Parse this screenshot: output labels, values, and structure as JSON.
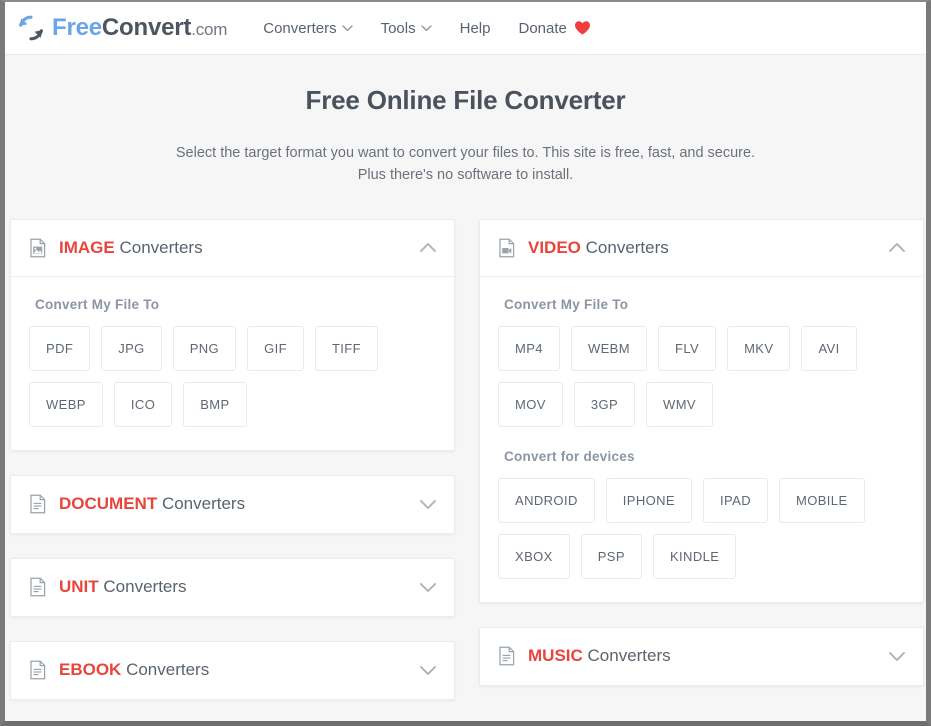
{
  "header": {
    "logo": {
      "icon": "refresh-circle-icon",
      "part1": "Free",
      "part2": "Convert",
      "part3": ".com"
    },
    "nav": [
      {
        "label": "Converters",
        "icon": "chevron-down-icon",
        "has_chevron": true
      },
      {
        "label": "Tools",
        "icon": "chevron-down-icon",
        "has_chevron": true
      },
      {
        "label": "Help",
        "has_chevron": false
      },
      {
        "label": "Donate",
        "icon": "heart-icon",
        "has_heart": true
      }
    ]
  },
  "hero": {
    "title": "Free Online File Converter",
    "subtitle": "Select the target format you want to convert your files to. This site is free, fast, and secure. Plus there's no software to install."
  },
  "colors": {
    "accent_red": "#e8453c",
    "logo_blue": "#6ba4e8",
    "text_gray": "#5a636d",
    "label_gray": "#8b95a3",
    "page_bg": "#f6f6f7",
    "card_bg": "#ffffff",
    "border": "#ececec",
    "heart_red": "#ee3d3d"
  },
  "left_column": [
    {
      "id": "image",
      "kind": "IMAGE",
      "suffix": " Converters",
      "icon": "file-image-icon",
      "expanded": true,
      "chevron": "chevron-up-icon",
      "groups": [
        {
          "label": "Convert My File To",
          "items": [
            "PDF",
            "JPG",
            "PNG",
            "GIF",
            "TIFF",
            "WEBP",
            "ICO",
            "BMP"
          ]
        }
      ]
    },
    {
      "id": "document",
      "kind": "DOCUMENT",
      "suffix": " Converters",
      "icon": "file-lines-icon",
      "expanded": false,
      "chevron": "chevron-down-icon",
      "groups": []
    },
    {
      "id": "unit",
      "kind": "UNIT",
      "suffix": " Converters",
      "icon": "file-lines-icon",
      "expanded": false,
      "chevron": "chevron-down-icon",
      "groups": []
    },
    {
      "id": "ebook",
      "kind": "EBOOK",
      "suffix": " Converters",
      "icon": "file-lines-icon",
      "expanded": false,
      "chevron": "chevron-down-icon",
      "groups": []
    }
  ],
  "right_column": [
    {
      "id": "video",
      "kind": "VIDEO",
      "suffix": " Converters",
      "icon": "file-video-icon",
      "expanded": true,
      "chevron": "chevron-up-icon",
      "groups": [
        {
          "label": "Convert My File To",
          "items": [
            "MP4",
            "WEBM",
            "FLV",
            "MKV",
            "AVI",
            "MOV",
            "3GP",
            "WMV"
          ]
        },
        {
          "label": "Convert for devices",
          "items": [
            "ANDROID",
            "IPHONE",
            "IPAD",
            "MOBILE",
            "XBOX",
            "PSP",
            "KINDLE"
          ]
        }
      ]
    },
    {
      "id": "music",
      "kind": "MUSIC",
      "suffix": " Converters",
      "icon": "file-lines-icon",
      "expanded": false,
      "chevron": "chevron-down-icon",
      "groups": []
    }
  ]
}
